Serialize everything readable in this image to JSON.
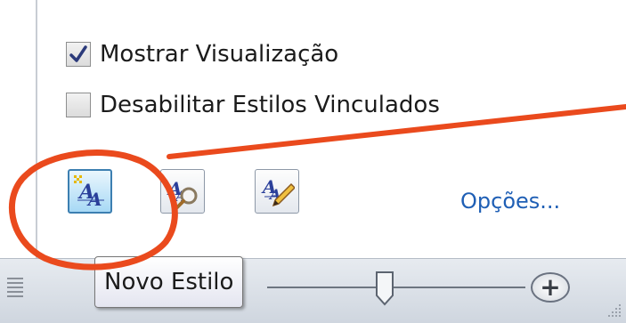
{
  "checkboxes": [
    {
      "label": "Mostrar Visualização",
      "checked": true
    },
    {
      "label": "Desabilitar Estilos Vinculados",
      "checked": false
    }
  ],
  "buttons": [
    {
      "name": "novo-estilo",
      "icon": "new-style-icon",
      "active": true
    },
    {
      "name": "inspetor-de-estilo",
      "icon": "style-inspector-icon",
      "active": false
    },
    {
      "name": "gerenciar-estilos",
      "icon": "manage-styles-icon",
      "active": false
    }
  ],
  "options_link": "Opções...",
  "tooltip": "Novo Estilo",
  "zoom": {
    "plus_symbol": "+"
  },
  "annotation": {
    "color": "#ea4a1d"
  },
  "colors": {
    "link": "#1f5fb5",
    "active_button_border": "#3c7fb1",
    "statusbar": "#dde2e8"
  }
}
